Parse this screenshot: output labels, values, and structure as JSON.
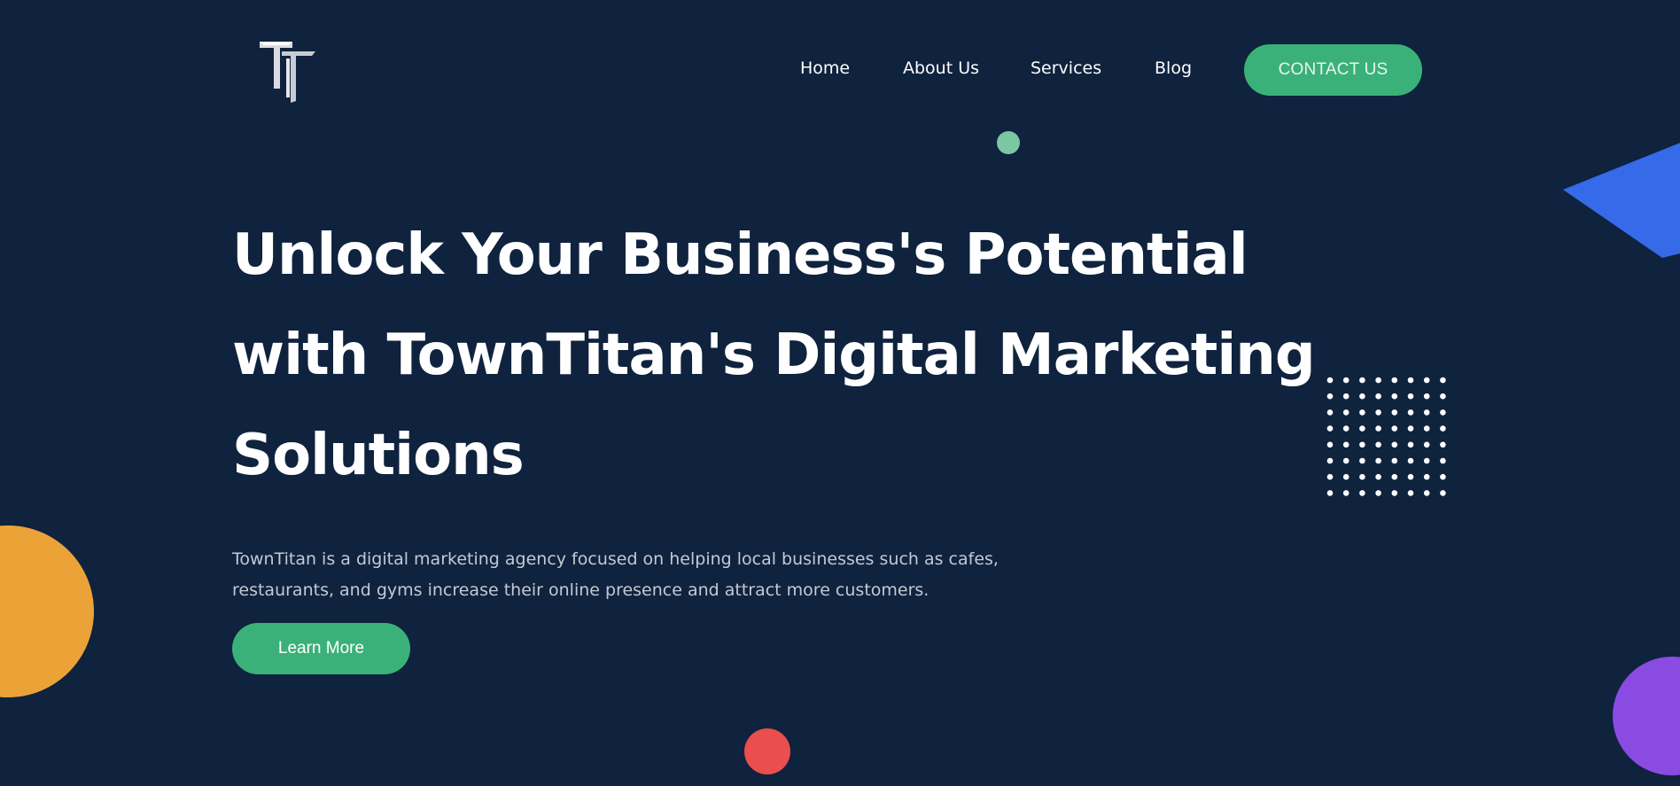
{
  "header": {
    "logo_alt": "TownTitan logo",
    "nav": [
      {
        "label": "Home"
      },
      {
        "label": "About Us"
      },
      {
        "label": "Services"
      },
      {
        "label": "Blog"
      }
    ],
    "contact_label": "CONTACT US"
  },
  "hero": {
    "title_lines": [
      "Unlock Your Business's Potential",
      "with TownTitan's Digital Marketing",
      "Solutions"
    ],
    "description_lines": [
      "TownTitan is a digital marketing agency focused on helping local businesses such as cafes,",
      "restaurants, and gyms increase their online presence and attract more customers."
    ],
    "cta_label": "Learn More"
  },
  "colors": {
    "background": "#0f223e",
    "accent_green": "#3ab178",
    "orange": "#eba337",
    "red": "#ea4e4f",
    "purple": "#8a4be3",
    "blue": "#376ae9",
    "mint": "#7cc6a3"
  },
  "icons": {
    "logo": "tt-monogram-icon"
  }
}
